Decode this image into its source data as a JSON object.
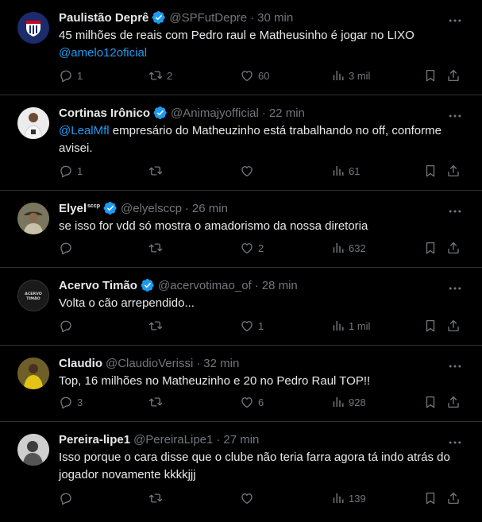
{
  "colors": {
    "background": "#000000",
    "text": "#e7e9ea",
    "muted": "#71767b",
    "link": "#1d9bf0",
    "verified": "#1d9bf0",
    "border": "#2f3336"
  },
  "icons": {
    "verified": "verified-badge-icon",
    "more": "more-icon",
    "reply": "reply-icon",
    "retweet": "retweet-icon",
    "like": "heart-icon",
    "views": "views-chart-icon",
    "bookmark": "bookmark-icon",
    "share": "share-icon"
  },
  "tweets": [
    {
      "name": "Paulistão Deprê",
      "handle": "@SPFutDepre",
      "separator": "·",
      "time": "30 min",
      "text": "45 milhões de reais com Pedro raul e Matheusinho é jogar no LIXO",
      "mention": "@amelo12oficial",
      "replies": "1",
      "retweets": "2",
      "likes": "60",
      "views": "3 mil"
    },
    {
      "name": "Cortinas Irônico",
      "handle": "@Animajyofficial",
      "separator": "·",
      "time": "22 min",
      "mention": "@LealMfl",
      "text": "empresário do Matheuzinho está trabalhando no off, conforme avisei.",
      "replies": "1",
      "retweets": "",
      "likes": "",
      "views": "61"
    },
    {
      "name": "Elyel",
      "name_suffix": "sccp",
      "handle": "@elyelsccp",
      "separator": "·",
      "time": "26 min",
      "text": "se isso for vdd só mostra o amadorismo da nossa diretoria",
      "replies": "",
      "retweets": "",
      "likes": "2",
      "views": "632"
    },
    {
      "name": "Acervo Timão",
      "handle": "@acervotimao_of",
      "separator": "·",
      "time": "28 min",
      "text": "Volta o cão arrependido...",
      "avatar_text": "ACERVO TIMÃO",
      "replies": "",
      "retweets": "",
      "likes": "1",
      "views": "1 mil"
    },
    {
      "name": "Claudio",
      "handle": "@ClaudioVerissi",
      "separator": "·",
      "time": "32 min",
      "text": "Top, 16 milhões no Matheuzinho e 20 no Pedro Raul TOP!!",
      "replies": "3",
      "retweets": "",
      "likes": "6",
      "views": "928"
    },
    {
      "name": "Pereira-lipe1",
      "handle": "@PereiraLipe1",
      "separator": "·",
      "time": "27 min",
      "text": "Isso porque o cara disse que o clube não teria farra agora tá indo atrás do jogador novamente kkkkjjj",
      "replies": "",
      "retweets": "",
      "likes": "",
      "views": "139"
    }
  ]
}
